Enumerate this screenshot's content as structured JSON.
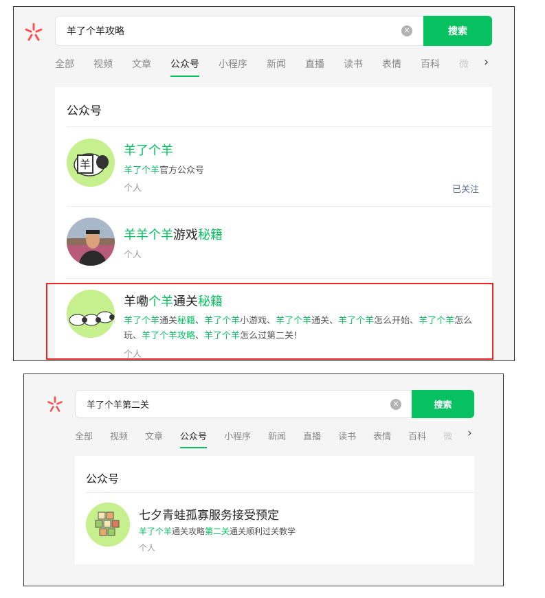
{
  "colors": {
    "accent": "#07c160",
    "highlight_box": "#e8261f",
    "logo": "#fa5151",
    "followed_link": "#576b95"
  },
  "screen1": {
    "search": {
      "value": "羊了个羊攻略",
      "button": "搜索"
    },
    "tabs": [
      {
        "label": "全部"
      },
      {
        "label": "视频"
      },
      {
        "label": "文章"
      },
      {
        "label": "公众号",
        "active": true
      },
      {
        "label": "小程序"
      },
      {
        "label": "新闻"
      },
      {
        "label": "直播"
      },
      {
        "label": "读书"
      },
      {
        "label": "表情"
      },
      {
        "label": "百科"
      },
      {
        "label": "微"
      }
    ],
    "section_title": "公众号",
    "results": [
      {
        "title": [
          {
            "t": "羊了个羊",
            "h": true
          }
        ],
        "desc": [
          {
            "t": "羊了个羊",
            "h": true
          },
          {
            "t": "官方公众号"
          }
        ],
        "type": "个人",
        "followed": "已关注",
        "avatar_icon": "sheep-logo-avatar",
        "avatar_char": "羊"
      },
      {
        "title": [
          {
            "t": "羊羊个羊",
            "h": true
          },
          {
            "t": "游戏"
          },
          {
            "t": "秘籍",
            "h": true
          }
        ],
        "type": "个人",
        "avatar_icon": "person-photo-avatar"
      },
      {
        "title": [
          {
            "t": "羊嘞"
          },
          {
            "t": "个羊",
            "h": true
          },
          {
            "t": "通关"
          },
          {
            "t": "秘籍",
            "h": true
          }
        ],
        "desc": [
          {
            "t": "羊了个羊",
            "h": true
          },
          {
            "t": "通关"
          },
          {
            "t": "秘籍",
            "h": true
          },
          {
            "t": "、"
          },
          {
            "t": "羊了个羊",
            "h": true
          },
          {
            "t": "小游戏、"
          },
          {
            "t": "羊了个羊",
            "h": true
          },
          {
            "t": "通关、"
          },
          {
            "t": "羊了个羊",
            "h": true
          },
          {
            "t": "怎么开始、"
          },
          {
            "t": "羊了个羊",
            "h": true
          },
          {
            "t": "怎么玩、"
          },
          {
            "t": "羊了个羊攻略",
            "h": true
          },
          {
            "t": "、"
          },
          {
            "t": "羊了个羊",
            "h": true
          },
          {
            "t": "怎么过第二关!"
          }
        ],
        "type": "个人",
        "avatar_icon": "sheep-flock-avatar"
      }
    ]
  },
  "screen2": {
    "search": {
      "value": "羊了个羊第二关",
      "button": "搜索"
    },
    "tabs": [
      {
        "label": "全部"
      },
      {
        "label": "视频"
      },
      {
        "label": "文章"
      },
      {
        "label": "公众号",
        "active": true
      },
      {
        "label": "小程序"
      },
      {
        "label": "新闻"
      },
      {
        "label": "直播"
      },
      {
        "label": "读书"
      },
      {
        "label": "表情"
      },
      {
        "label": "百科"
      },
      {
        "label": "微"
      }
    ],
    "section_title": "公众号",
    "results": [
      {
        "title": [
          {
            "t": "七夕青蛙孤寡服务接受预定"
          }
        ],
        "desc": [
          {
            "t": "羊了个羊",
            "h": true
          },
          {
            "t": "通关攻略"
          },
          {
            "t": "第二关",
            "h": true
          },
          {
            "t": "通关顺利过关教学"
          }
        ],
        "type": "个人",
        "avatar_icon": "game-tiles-avatar"
      }
    ]
  }
}
